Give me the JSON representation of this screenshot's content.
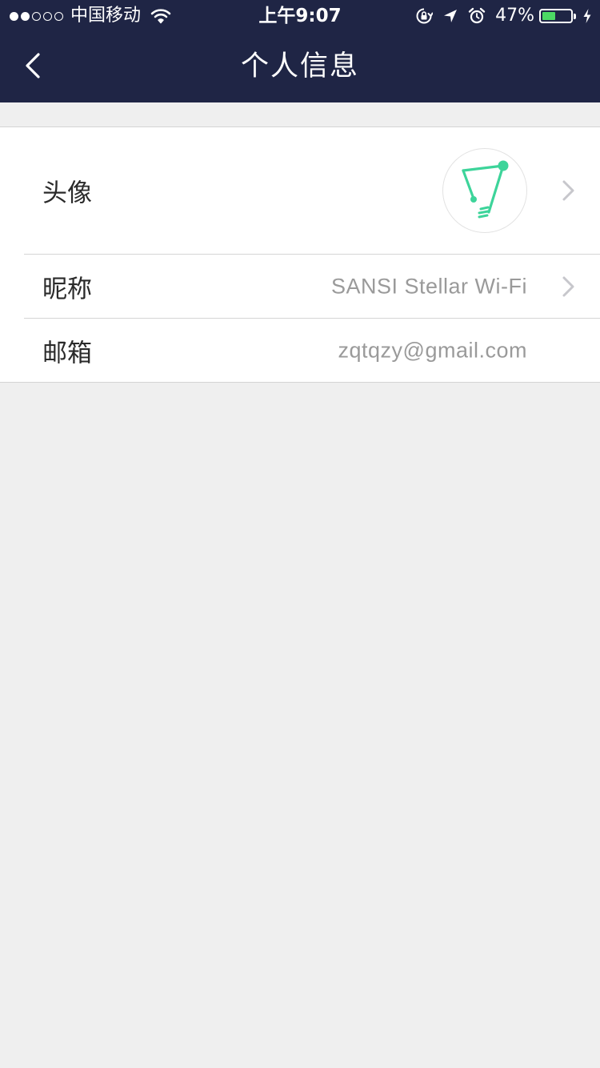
{
  "status_bar": {
    "carrier": "中国移动",
    "time": "上午9:07",
    "battery_percent": "47%",
    "battery_level": 0.47,
    "signal_bars_filled": 2,
    "signal_bars_total": 5
  },
  "nav": {
    "title": "个人信息",
    "back_icon": "chevron-left-icon"
  },
  "profile": {
    "avatar_label": "头像",
    "nickname_label": "昵称",
    "nickname_value": "SANSI Stellar Wi-Fi",
    "email_label": "邮箱",
    "email_value": "zqtqzy@gmail.com"
  },
  "colors": {
    "nav_background": "#1f2545",
    "page_background": "#efefef",
    "accent_green": "#3dd49a",
    "battery_green": "#4cd964"
  }
}
